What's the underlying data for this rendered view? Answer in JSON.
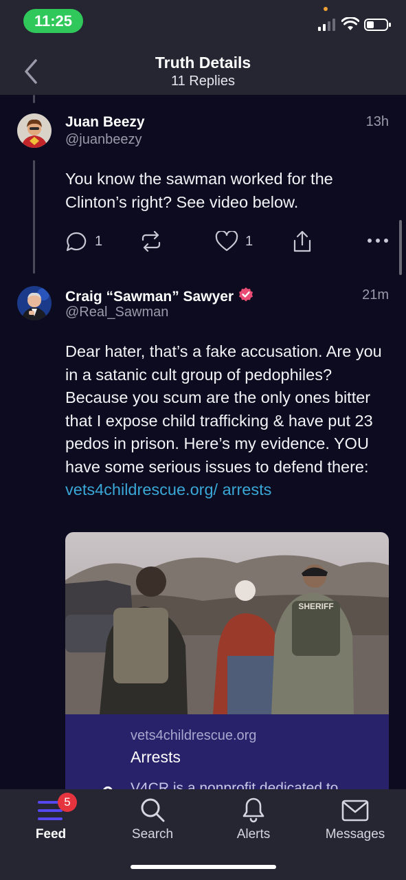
{
  "status_bar": {
    "time": "11:25"
  },
  "header": {
    "title": "Truth Details",
    "subtitle": "11 Replies"
  },
  "posts": [
    {
      "name": "Juan Beezy",
      "handle": "@juanbeezy",
      "time": "13h",
      "text": "You know the sawman worked for the Clinton’s right? See video below.",
      "reply_count": "1",
      "like_count": "1"
    },
    {
      "name": "Craig “Sawman” Sawyer",
      "handle": "@Real_Sawman",
      "time": "21m",
      "text": "Dear hater, that’s a fake accusation. Are you in a satanic cult group of pedophiles? Because you scum are the only ones bitter that I expose child trafficking & have put 23 pedos in prison. Here’s my evidence. YOU have some serious issues to defend there: ",
      "link_text": "vets4childrescue.org/ arrests",
      "card": {
        "domain": "vets4childrescue.org",
        "title": "Arrests",
        "description": "V4CR is a nonprofit dedicated to",
        "image_text": "SHERIFF"
      }
    }
  ],
  "tabbar": {
    "items": [
      {
        "label": "Feed",
        "icon": "feed-icon"
      },
      {
        "label": "Search",
        "icon": "search-icon"
      },
      {
        "label": "Alerts",
        "icon": "bell-icon"
      },
      {
        "label": "Messages",
        "icon": "envelope-icon"
      }
    ],
    "feed_badge": "5"
  },
  "colors": {
    "accent": "#5448ee",
    "link": "#3aa7d7",
    "verified": "#e84c74",
    "badge": "#e5343e",
    "status_pill": "#30c85a"
  }
}
